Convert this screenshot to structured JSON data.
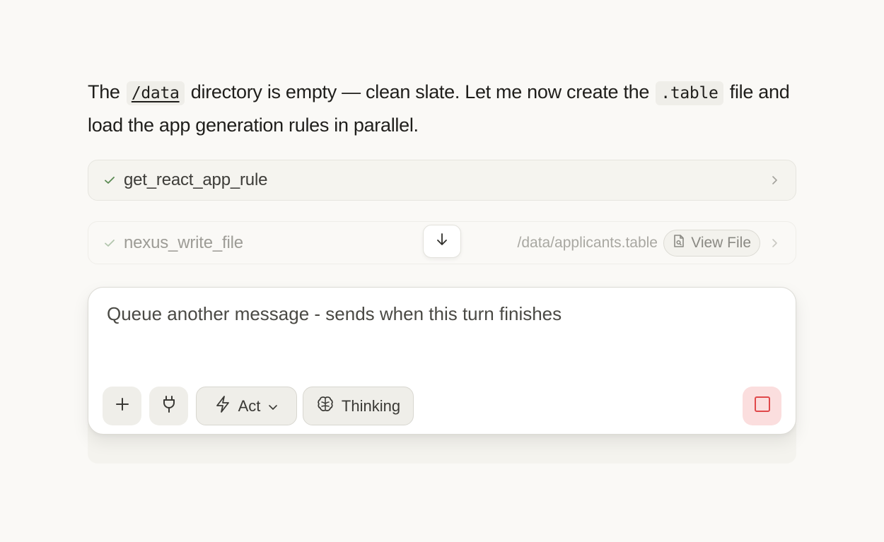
{
  "message": {
    "part1": "The",
    "code1": "/data",
    "part2": "directory is empty — clean slate. Let me now create the",
    "code2": ".table",
    "part3": "file and load the app generation rules in parallel."
  },
  "tools": [
    {
      "name": "get_react_app_rule",
      "status": "done",
      "icon": "check-icon"
    },
    {
      "name": "nexus_write_file",
      "status": "done",
      "icon": "check-icon",
      "path": "/data/applicants.table",
      "view_label": "View File"
    }
  ],
  "composer": {
    "placeholder": "Queue another message - sends when this turn finishes",
    "mode_label": "Act",
    "thinking_label": "Thinking"
  },
  "colors": {
    "check": "#5a8a52",
    "stop": "#e0484a",
    "stop_bg": "#fbdede"
  }
}
